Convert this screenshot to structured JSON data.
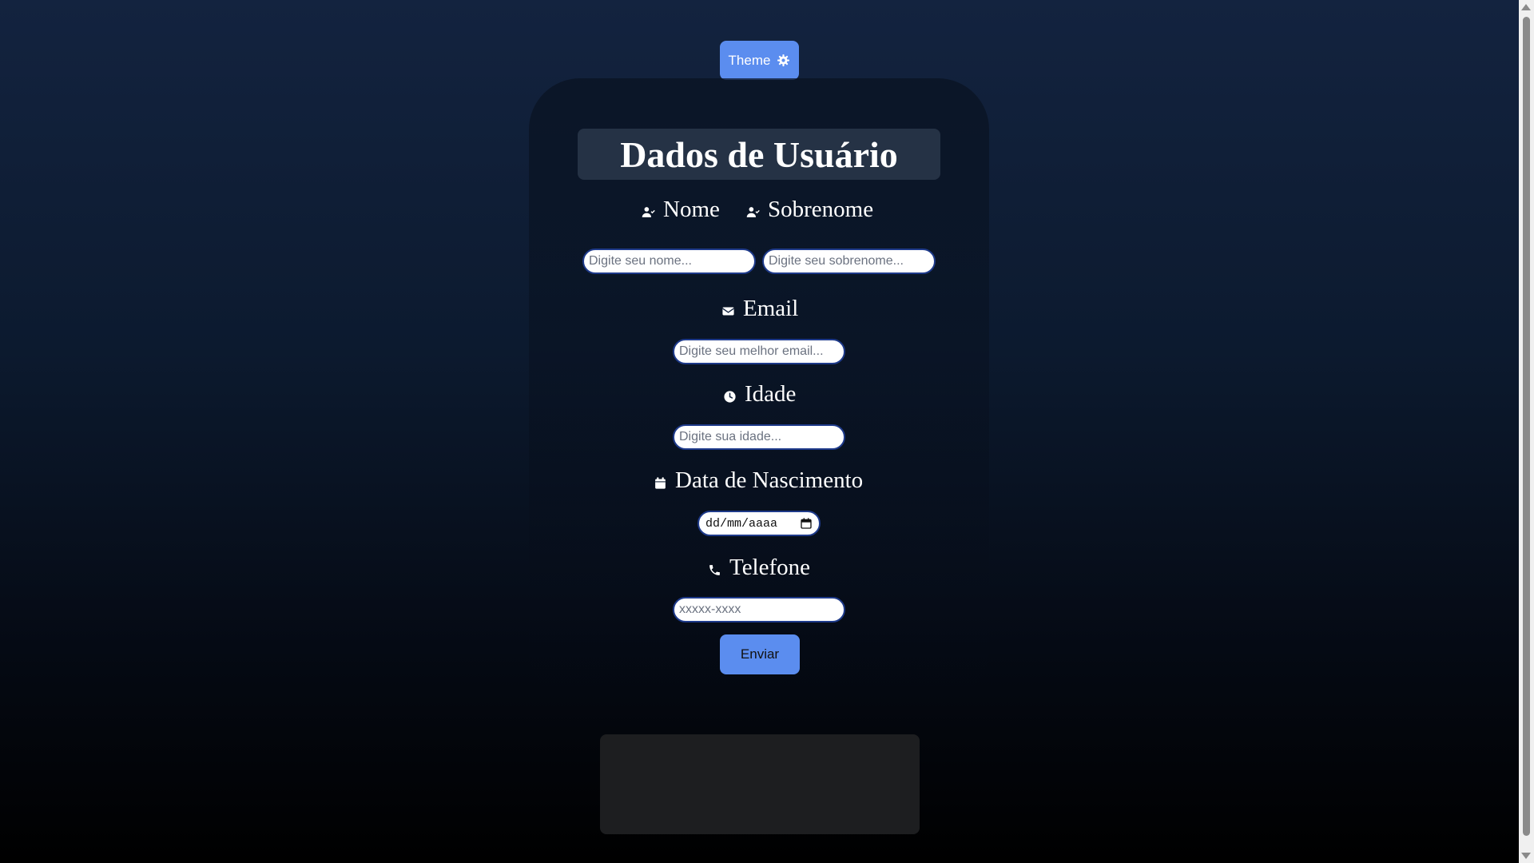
{
  "theme_button": {
    "label": "Theme",
    "icon": "gear-icon"
  },
  "form": {
    "title": "Dados de Usuário",
    "fields": {
      "nome": {
        "label": "Nome",
        "icon": "user-icon",
        "placeholder": "Digite seu nome..."
      },
      "sobrenome": {
        "label": "Sobrenome",
        "icon": "user-icon",
        "placeholder": "Digite seu sobrenome..."
      },
      "email": {
        "label": "Email",
        "icon": "envelope-icon",
        "placeholder": "Digite seu melhor email..."
      },
      "idade": {
        "label": "Idade",
        "icon": "clock-icon",
        "placeholder": "Digite sua idade..."
      },
      "nascimento": {
        "label": "Data de Nascimento",
        "icon": "calendar-icon",
        "placeholder": "dd/mm/aaaa"
      },
      "telefone": {
        "label": "Telefone",
        "icon": "phone-icon",
        "placeholder": "xxxxx-xxxx"
      }
    },
    "submit_label": "Enviar"
  },
  "colors": {
    "accent": "#5b8def",
    "title_bg": "#253245",
    "result_bg": "#1d1e20",
    "bg_top": "#13233f",
    "bg_bottom": "#000000"
  }
}
